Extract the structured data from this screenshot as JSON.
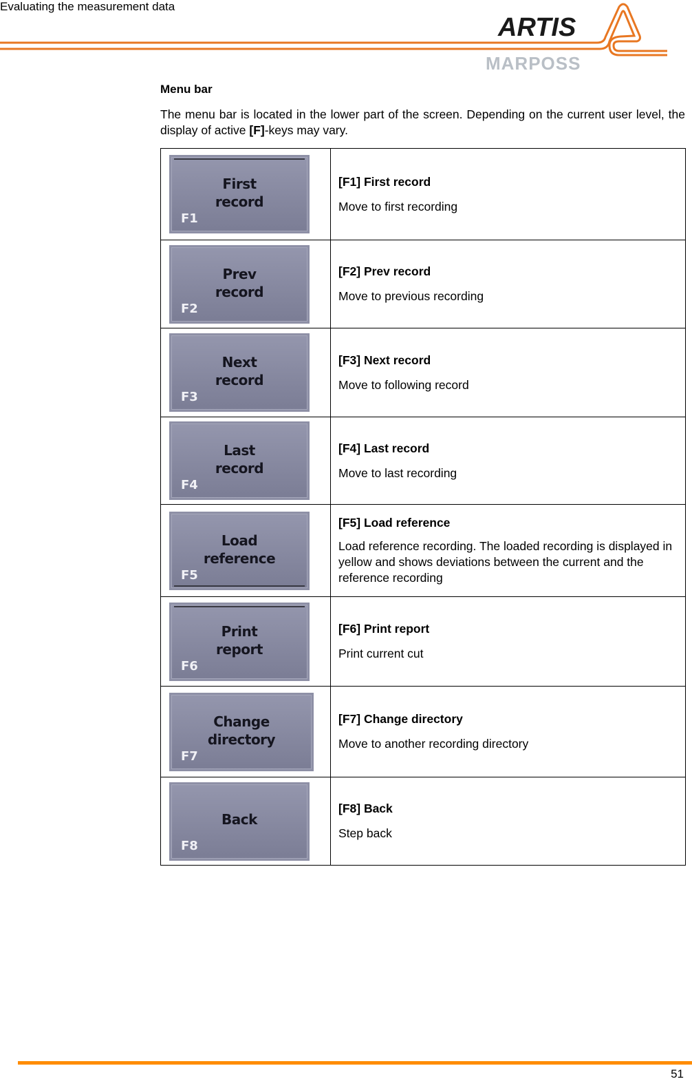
{
  "header": {
    "section_title": "Evaluating the measurement data",
    "logo_brand": "ARTIS",
    "logo_sub": "MARPOSS",
    "accent_color": "#e87722"
  },
  "main": {
    "heading": "Menu bar",
    "intro_before": "The menu bar is located in the lower part of the screen. Depending on the current user level, the display of active ",
    "intro_bold": "[F]",
    "intro_after": "-keys may vary.",
    "keys": [
      {
        "key": "F1",
        "button_line1": "First",
        "button_line2": "record",
        "title": "[F1] First record",
        "description": "Move to first recording"
      },
      {
        "key": "F2",
        "button_line1": "Prev",
        "button_line2": "record",
        "title": "[F2] Prev record",
        "description": "Move to previous recording"
      },
      {
        "key": "F3",
        "button_line1": "Next",
        "button_line2": "record",
        "title": "[F3] Next record",
        "description": "Move to following record"
      },
      {
        "key": "F4",
        "button_line1": "Last",
        "button_line2": "record",
        "title": "[F4] Last record",
        "description": "Move to last recording"
      },
      {
        "key": "F5",
        "button_line1": "Load",
        "button_line2": "reference",
        "title": "[F5] Load reference",
        "description": "Load reference recording. The loaded recording is displayed in yellow and shows deviations between the current and the reference recording"
      },
      {
        "key": "F6",
        "button_line1": "Print",
        "button_line2": "report",
        "title": "[F6] Print report",
        "description": "Print current cut"
      },
      {
        "key": "F7",
        "button_line1": "Change",
        "button_line2": "directory",
        "title": "[F7] Change directory",
        "description": "Move to another recording directory"
      },
      {
        "key": "F8",
        "button_line1": "Back",
        "button_line2": "",
        "title": "[F8] Back",
        "description": "Step back"
      }
    ]
  },
  "footer": {
    "page_number": "51",
    "line_color": "#ff8c00"
  }
}
